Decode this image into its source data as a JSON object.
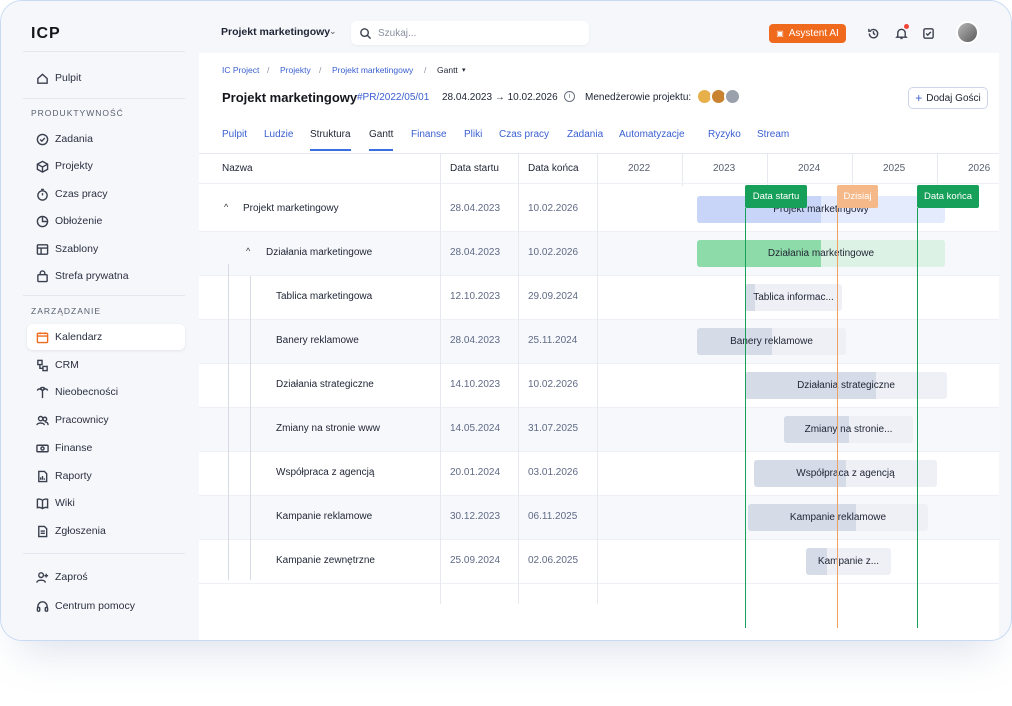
{
  "app": {
    "logo": "ICP"
  },
  "sidebar": {
    "top": [
      {
        "label": "Pulpit",
        "icon": "home-icon"
      }
    ],
    "section1": "PRODUKTYWNOŚĆ",
    "items1": [
      {
        "label": "Zadania",
        "icon": "check-circle-icon"
      },
      {
        "label": "Projekty",
        "icon": "box-icon"
      },
      {
        "label": "Czas pracy",
        "icon": "stopwatch-icon"
      },
      {
        "label": "Obłożenie",
        "icon": "chart-icon"
      },
      {
        "label": "Szablony",
        "icon": "layout-icon"
      },
      {
        "label": "Strefa prywatna",
        "icon": "lock-bag-icon"
      }
    ],
    "section2": "ZARZĄDZANIE",
    "items2": [
      {
        "label": "Kalendarz",
        "icon": "calendar-icon"
      },
      {
        "label": "CRM",
        "icon": "crm-icon"
      },
      {
        "label": "Nieobecności",
        "icon": "palm-icon"
      },
      {
        "label": "Pracownicy",
        "icon": "people-icon"
      },
      {
        "label": "Finanse",
        "icon": "money-icon"
      },
      {
        "label": "Raporty",
        "icon": "report-icon"
      },
      {
        "label": "Wiki",
        "icon": "book-icon"
      },
      {
        "label": "Zgłoszenia",
        "icon": "ticket-icon"
      }
    ],
    "bottom": [
      {
        "label": "Zaproś",
        "icon": "user-plus-icon"
      },
      {
        "label": "Centrum pomocy",
        "icon": "headset-icon"
      }
    ]
  },
  "topbar": {
    "project": "Projekt marketingowy",
    "search_placeholder": "Szukaj...",
    "ai_label": "Asystent AI"
  },
  "breadcrumb": [
    "IC Project",
    "Projekty",
    "Projekt marketingowy",
    "Gantt"
  ],
  "project": {
    "title": "Projekt marketingowy",
    "code": "#PR/2022/05/01",
    "dates": "28.04.2023 → 10.02.2026",
    "managers_label": "Menedżerowie projektu:",
    "guest_label": "Dodaj Gości"
  },
  "tabs": [
    "Pulpit",
    "Ludzie",
    "Struktura",
    "Gantt",
    "Finanse",
    "Pliki",
    "Czas pracy",
    "Zadania",
    "Automatyzacje",
    "Ryzyko",
    "Stream"
  ],
  "table": {
    "col_name": "Nazwa",
    "col_start": "Data startu",
    "col_end": "Data końca"
  },
  "years": [
    "2022",
    "2023",
    "2024",
    "2025",
    "2026"
  ],
  "markers": {
    "start": "Data startu",
    "today": "Dzisiaj",
    "end": "Data końca"
  },
  "rows": [
    {
      "name": "Projekt marketingowy",
      "start": "28.04.2023",
      "end": "10.02.2026",
      "bar": "Projekt marketingowy",
      "progress": 0.5
    },
    {
      "name": "Działania marketingowe",
      "start": "28.04.2023",
      "end": "10.02.2026",
      "bar": "Działania marketingowe",
      "progress": 0.5
    },
    {
      "name": "Tablica marketingowa",
      "start": "12.10.2023",
      "end": "29.09.2024",
      "bar": "Tablica informac...",
      "progress": 0.1
    },
    {
      "name": "Banery reklamowe",
      "start": "28.04.2023",
      "end": "25.11.2024",
      "bar": "Banery reklamowe",
      "progress": 0.5
    },
    {
      "name": "Działania strategiczne",
      "start": "14.10.2023",
      "end": "10.02.2026",
      "bar": "Działania strategiczne",
      "progress": 0.65
    },
    {
      "name": "Zmiany na stronie www",
      "start": "14.05.2024",
      "end": "31.07.2025",
      "bar": "Zmiany na stronie...",
      "progress": 0.5
    },
    {
      "name": "Współpraca z agencją",
      "start": "20.01.2024",
      "end": "03.01.2026",
      "bar": "Współpraca z agencją",
      "progress": 0.5
    },
    {
      "name": "Kampanie reklamowe",
      "start": "30.12.2023",
      "end": "06.11.2025",
      "bar": "Kampanie reklamowe",
      "progress": 0.6
    },
    {
      "name": "Kampanie zewnętrzne",
      "start": "25.09.2024",
      "end": "02.06.2025",
      "bar": "Kampanie z...",
      "progress": 0.25
    }
  ]
}
